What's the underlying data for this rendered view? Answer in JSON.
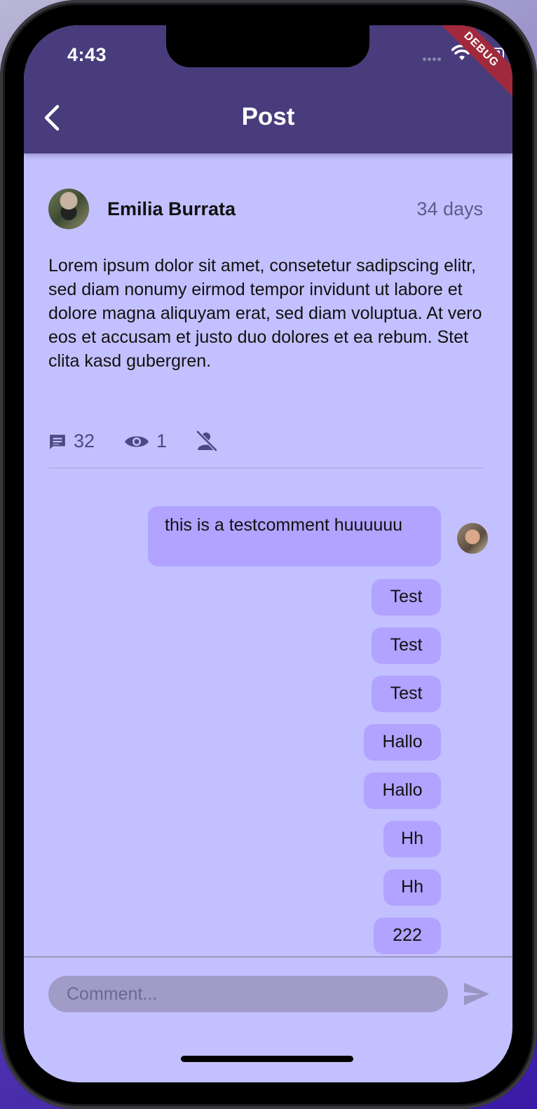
{
  "status_bar": {
    "time": "4:43",
    "debug_banner": "DEBUG"
  },
  "app_bar": {
    "title": "Post"
  },
  "post": {
    "author": "Emilia Burrata",
    "age": "34 days",
    "body": "Lorem ipsum dolor sit amet, consetetur sadipscing elitr, sed diam nonumy eirmod tempor invidunt ut labore et dolore magna aliquyam erat, sed diam voluptua. At vero eos et accusam et justo duo dolores et ea rebum. Stet clita kasd gubergren.",
    "stats": {
      "comments": "32",
      "views": "1"
    }
  },
  "comments": [
    {
      "text": "this is a testcomment huuuuuu"
    },
    {
      "text": "Test"
    },
    {
      "text": "Test"
    },
    {
      "text": "Test"
    },
    {
      "text": "Hallo"
    },
    {
      "text": "Hallo"
    },
    {
      "text": "Hh"
    },
    {
      "text": "Hh"
    },
    {
      "text": "222"
    }
  ],
  "composer": {
    "placeholder": "Comment..."
  },
  "colors": {
    "app_bar": "#493c7c",
    "background": "#c3c0ff",
    "bubble": "#b1a3ff",
    "input": "#a09bc7"
  },
  "icons": {
    "back": "chevron-left-icon",
    "comments": "comment-icon",
    "views": "eye-icon",
    "notifications": "person-off-icon",
    "send": "send-icon"
  }
}
